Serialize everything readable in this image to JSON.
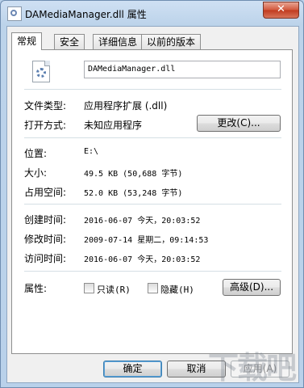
{
  "window": {
    "title": "DAMediaManager.dll 属性",
    "close_glyph": "✕"
  },
  "tabs": [
    {
      "label": "常规",
      "active": true
    },
    {
      "label": "安全",
      "active": false
    },
    {
      "label": "详细信息",
      "active": false
    },
    {
      "label": "以前的版本",
      "active": false
    }
  ],
  "general": {
    "file_name": "DAMediaManager.dll",
    "file_type_label": "文件类型:",
    "file_type_value": "应用程序扩展 (.dll)",
    "open_with_label": "打开方式:",
    "open_with_value": "未知应用程序",
    "change_button": "更改(C)...",
    "location_label": "位置:",
    "location_value": "E:\\",
    "size_label": "大小:",
    "size_value": "49.5 KB (50,688 字节)",
    "disk_size_label": "占用空间:",
    "disk_size_value": "52.0 KB (53,248 字节)",
    "created_label": "创建时间:",
    "created_value": "2016-06-07 今天，20:03:52",
    "modified_label": "修改时间:",
    "modified_value": "2009-07-14 星期二，09:14:53",
    "accessed_label": "访问时间:",
    "accessed_value": "2016-06-07 今天，20:03:52",
    "attributes_label": "属性:",
    "readonly_label": "只读(R)",
    "hidden_label": "隐藏(H)",
    "advanced_button": "高级(D)..."
  },
  "footer": {
    "ok_button": "确定",
    "cancel_button": "取消",
    "apply_button": "应用(A)"
  },
  "watermark_text": "下载吧"
}
